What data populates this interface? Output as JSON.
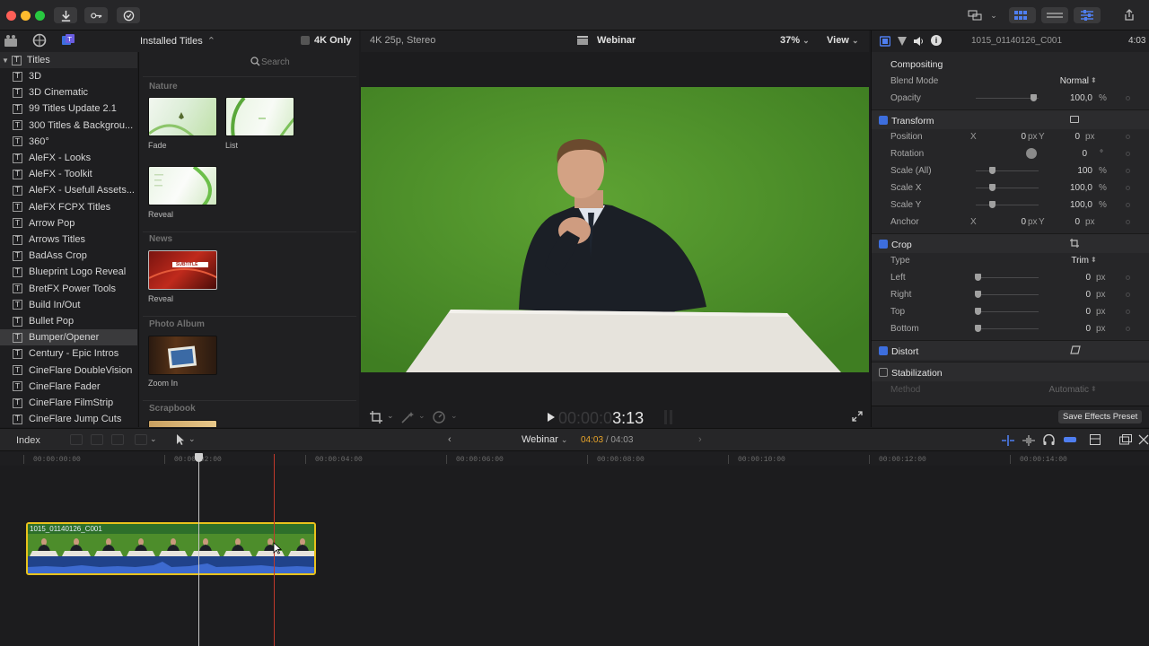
{
  "browser": {
    "dropdown_label": "Installed Titles",
    "dropdown_arrow": "⌃",
    "filter_label": "4K Only",
    "search_placeholder": "Search",
    "sidebar_root": "Titles",
    "sidebar_items": [
      "3D",
      "3D Cinematic",
      "99 Titles Update 2.1",
      "300 Titles & Backgrou...",
      "360°",
      "AleFX - Looks",
      "AleFX - Toolkit",
      "AleFX - Usefull Assets...",
      "AleFX FCPX Titles",
      "Arrow Pop",
      "Arrows Titles",
      "BadAss Crop",
      "Blueprint Logo Reveal",
      "BretFX Power Tools",
      "Build In/Out",
      "Bullet Pop",
      "Bumper/Opener",
      "Century - Epic Intros",
      "CineFlare DoubleVision",
      "CineFlare Fader",
      "CineFlare FilmStrip",
      "CineFlare Jump Cuts"
    ],
    "selected_item": "Bumper/Opener",
    "groups": [
      {
        "name": "Nature",
        "items": [
          "Fade",
          "List",
          "Reveal"
        ]
      },
      {
        "name": "News",
        "items": [
          "Reveal"
        ]
      },
      {
        "name": "Photo Album",
        "items": [
          "Zoom In"
        ]
      },
      {
        "name": "Scrapbook",
        "items": []
      }
    ],
    "news_thumb_text": "SUBTITLE"
  },
  "viewer": {
    "format": "4K 25p, Stereo",
    "project_name": "Webinar",
    "zoom": "37%",
    "view_label": "View",
    "timecode_dim": "00:00:0",
    "timecode_bright": "3:13"
  },
  "inspector": {
    "clip_name": "1015_01140126_C001",
    "duration": "4:03",
    "compositing_label": "Compositing",
    "blend_mode_label": "Blend Mode",
    "blend_mode_value": "Normal",
    "opacity_label": "Opacity",
    "opacity_value": "100,0",
    "opacity_unit": "%",
    "transform_label": "Transform",
    "position_label": "Position",
    "position_x_label": "X",
    "position_x": "0",
    "position_y_label": "Y",
    "position_y": "0",
    "px": "px",
    "rotation_label": "Rotation",
    "rotation_value": "0",
    "rotation_unit": "°",
    "scale_all_label": "Scale (All)",
    "scale_all_value": "100",
    "scale_x_label": "Scale X",
    "scale_x_value": "100,0",
    "scale_y_label": "Scale Y",
    "scale_y_value": "100,0",
    "anchor_label": "Anchor",
    "anchor_x": "0",
    "anchor_y": "0",
    "crop_label": "Crop",
    "type_label": "Type",
    "type_value": "Trim",
    "left_label": "Left",
    "left_value": "0",
    "right_label": "Right",
    "right_value": "0",
    "top_label": "Top",
    "top_value": "0",
    "bottom_label": "Bottom",
    "bottom_value": "0",
    "distort_label": "Distort",
    "stabilization_label": "Stabilization",
    "method_label": "Method",
    "method_value": "Automatic",
    "save_preset_label": "Save Effects Preset"
  },
  "timeline": {
    "index_label": "Index",
    "project_name": "Webinar",
    "position": "04:03",
    "duration": "/ 04:03",
    "ruler": [
      "00:00:00:00",
      "00:00:02:00",
      "00:00:04:00",
      "00:00:06:00",
      "00:00:08:00",
      "00:00:10:00",
      "00:00:12:00",
      "00:00:14:00"
    ],
    "clip_name": "1015_01140126_C001"
  },
  "colors": {
    "accent_blue": "#3d6edd",
    "clip_border": "#e8c21c",
    "playhead": "#c8c8c8",
    "skimmer": "#c0392b",
    "green_screen": "#4c8f2a"
  }
}
